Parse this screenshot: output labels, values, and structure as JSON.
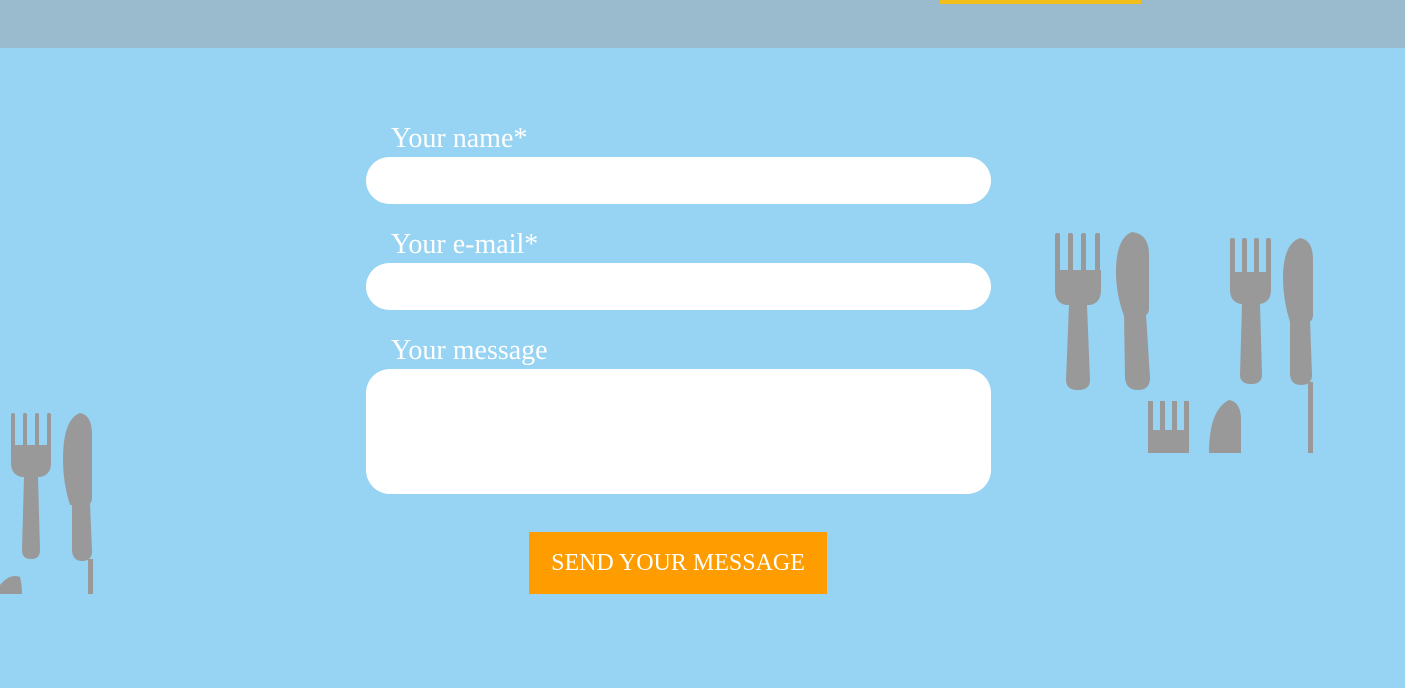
{
  "header": {
    "accent_color": "#f3bd1c",
    "background_color": "#9abace"
  },
  "page": {
    "background_color": "#97d3f3"
  },
  "contact_form": {
    "name": {
      "label": "Your name*",
      "value": "",
      "placeholder": ""
    },
    "email": {
      "label": "Your e-mail*",
      "value": "",
      "placeholder": ""
    },
    "message": {
      "label": "Your message",
      "value": "",
      "placeholder": ""
    },
    "submit_label": "SEND YOUR MESSAGE",
    "submit_color": "#fe9c00"
  },
  "decorations": {
    "icon_set": "fork-and-knife-icon",
    "icon_color": "#999999"
  }
}
